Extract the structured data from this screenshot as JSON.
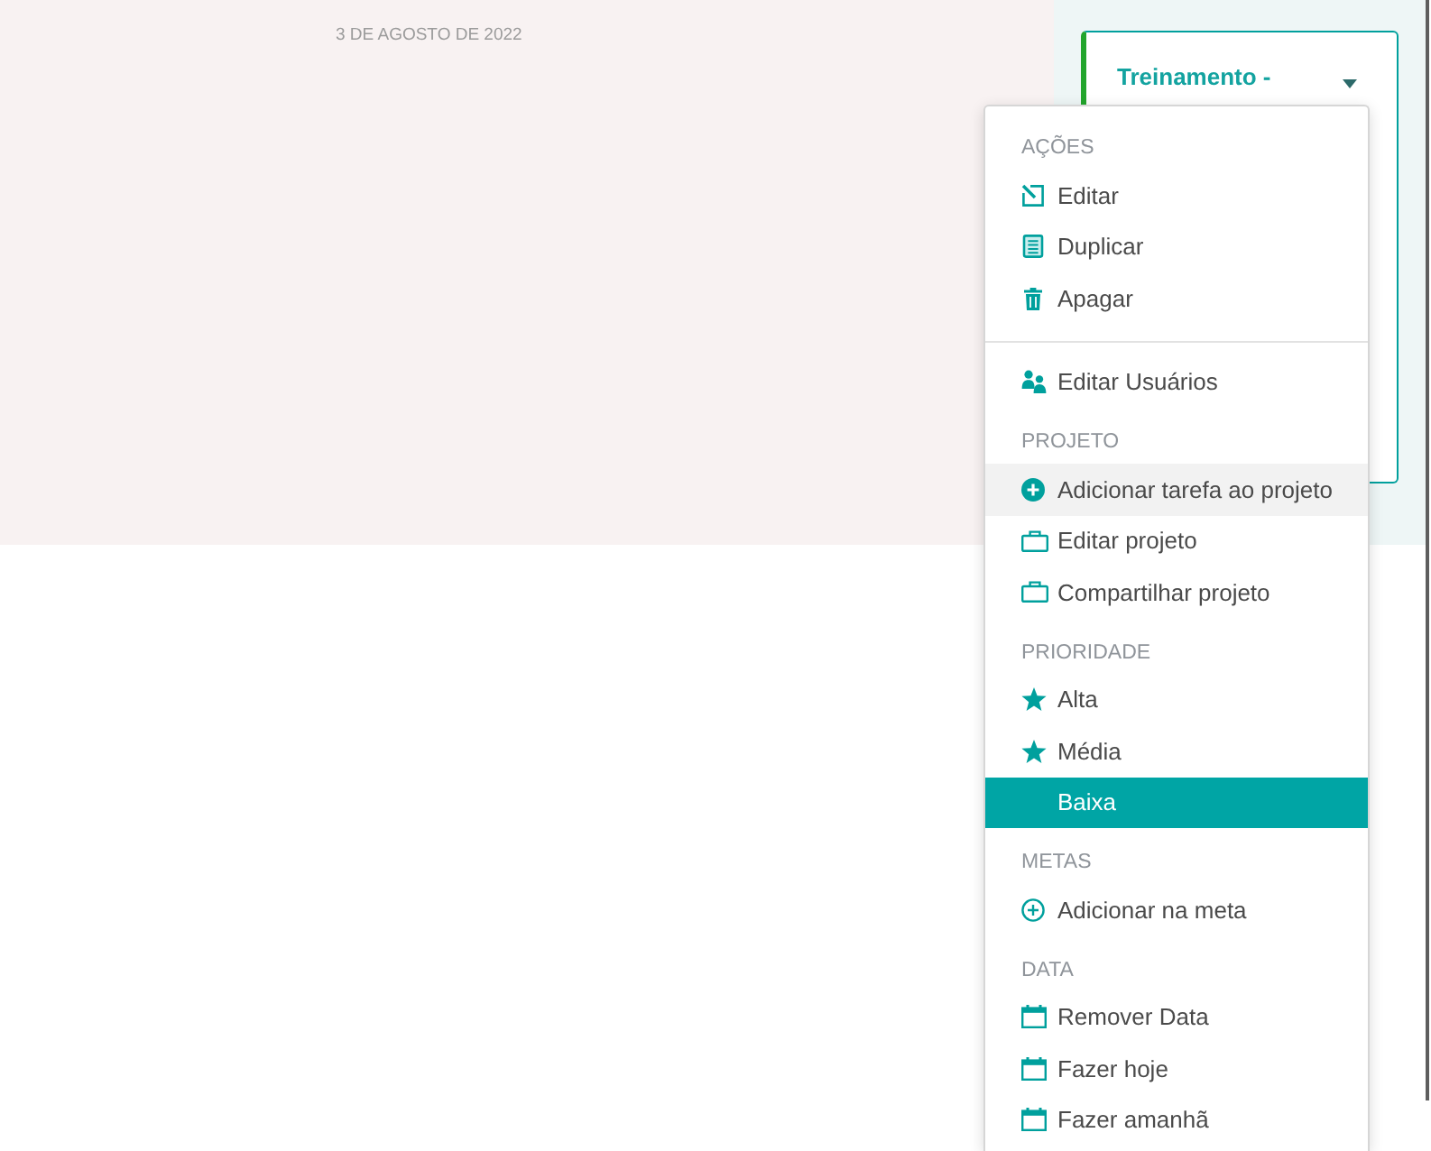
{
  "date_label": "3 DE AGOSTO DE 2022",
  "card": {
    "title": "Treinamento -"
  },
  "menu": {
    "sections": [
      {
        "header": "AÇÕES",
        "divider": false,
        "items": [
          {
            "label": "Editar",
            "kind": "edit",
            "highlighted": false,
            "selected": false
          },
          {
            "label": "Duplicar",
            "kind": "duplicate",
            "highlighted": false,
            "selected": false
          },
          {
            "label": "Apagar",
            "kind": "delete",
            "highlighted": false,
            "selected": false
          }
        ]
      },
      {
        "divider": true,
        "items": [
          {
            "label": "Editar Usuários",
            "kind": "users",
            "highlighted": false,
            "selected": false
          }
        ]
      },
      {
        "header": "PROJETO",
        "divider": false,
        "items": [
          {
            "label": "Adicionar tarefa ao projeto",
            "kind": "add",
            "highlighted": true,
            "selected": false
          },
          {
            "label": "Editar projeto",
            "kind": "project",
            "highlighted": false,
            "selected": false
          },
          {
            "label": "Compartilhar projeto",
            "kind": "project",
            "highlighted": false,
            "selected": false
          }
        ]
      },
      {
        "header": "PRIORIDADE",
        "divider": false,
        "items": [
          {
            "label": "Alta",
            "kind": "priority",
            "highlighted": false,
            "selected": false
          },
          {
            "label": "Média",
            "kind": "priority",
            "highlighted": false,
            "selected": false
          },
          {
            "label": "Baixa",
            "kind": "none",
            "highlighted": false,
            "selected": true
          }
        ]
      },
      {
        "header": "METAS",
        "divider": false,
        "items": [
          {
            "label": "Adicionar na meta",
            "kind": "goal",
            "highlighted": false,
            "selected": false
          }
        ]
      },
      {
        "header": "DATA",
        "divider": false,
        "items": [
          {
            "label": "Remover Data",
            "kind": "date",
            "highlighted": false,
            "selected": false
          },
          {
            "label": "Fazer hoje",
            "kind": "date",
            "highlighted": false,
            "selected": false
          },
          {
            "label": "Fazer amanhã",
            "kind": "date",
            "highlighted": false,
            "selected": false
          }
        ]
      }
    ]
  }
}
